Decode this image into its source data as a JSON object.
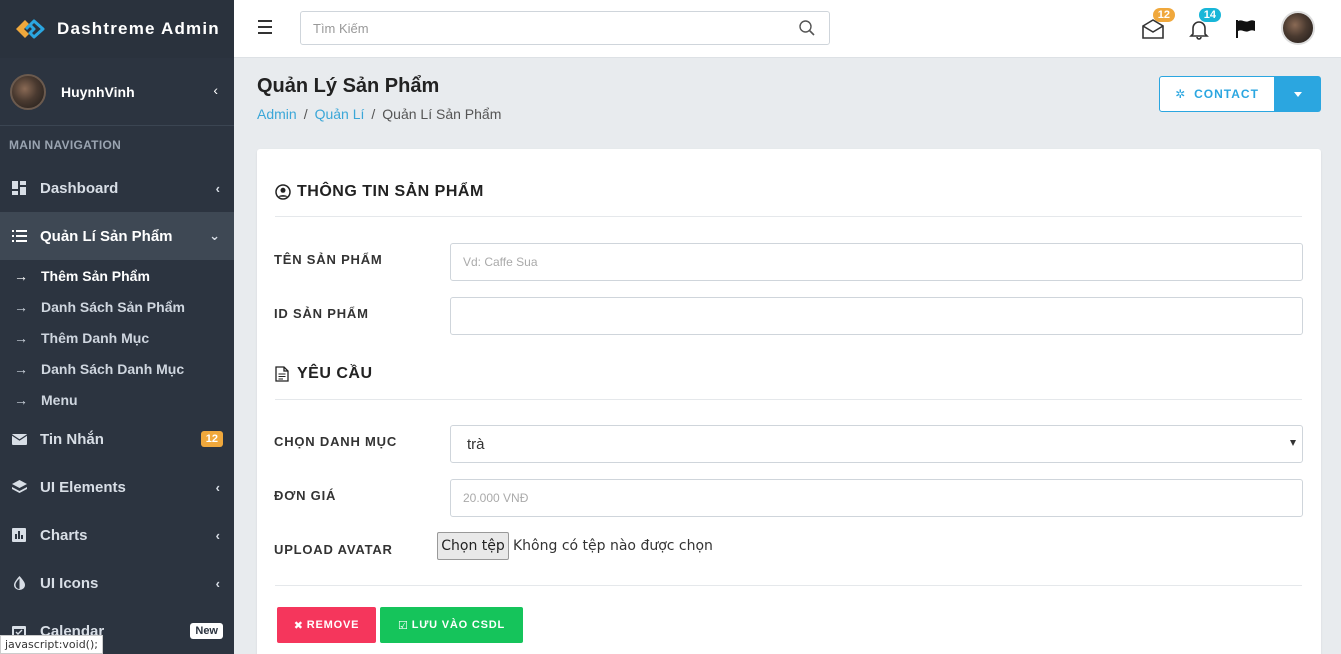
{
  "brand": {
    "name": "Dashtreme Admin"
  },
  "user": {
    "name": "HuynhVinh"
  },
  "sidebar": {
    "header": "MAIN NAVIGATION",
    "items": [
      {
        "label": "Dashboard",
        "icon": "dashboard-icon"
      },
      {
        "label": "Quản Lí Sản Phẩm",
        "icon": "list-icon"
      },
      {
        "label": "Tin Nhắn",
        "icon": "envelope-icon",
        "badge": "12"
      },
      {
        "label": "UI Elements",
        "icon": "layers-icon"
      },
      {
        "label": "Charts",
        "icon": "chart-icon"
      },
      {
        "label": "UI Icons",
        "icon": "contrast-icon"
      },
      {
        "label": "Calendar",
        "icon": "calendar-icon",
        "badge": "New"
      }
    ],
    "subitems": [
      {
        "label": "Thêm Sản Phẩm"
      },
      {
        "label": "Danh Sách Sản Phẩm"
      },
      {
        "label": "Thêm Danh Mục"
      },
      {
        "label": "Danh Sách Danh Mục"
      },
      {
        "label": "Menu"
      }
    ]
  },
  "status_tip": "javascript:void();",
  "topbar": {
    "search_placeholder": "Tìm Kiếm",
    "mail_badge": "12",
    "bell_badge": "14",
    "badge_colors": {
      "mail": "#f0a83c",
      "bell": "#18b6d8"
    }
  },
  "page": {
    "title": "Quản Lý Sản Phẩm",
    "breadcrumb": [
      "Admin",
      "Quản Lí",
      "Quản Lí Sản Phẩm"
    ],
    "contact_label": "CONTACT"
  },
  "form": {
    "section1_title": "THÔNG TIN SẢN PHẨM",
    "name_label": "TÊN SẢN PHẨM",
    "name_placeholder": "Vd: Caffe Sua",
    "id_label": "ID SẢN PHẨM",
    "id_value": "",
    "section2_title": "YÊU CẦU",
    "category_label": "CHỌN DANH MỤC",
    "category_value": "trà",
    "price_label": "ĐƠN GIÁ",
    "price_placeholder": "20.000 VNĐ",
    "avatar_label": "UPLOAD AVATAR",
    "file_button": "Chọn tệp",
    "file_status": "Không có tệp nào được chọn",
    "remove_label": "REMOVE",
    "save_label": "LƯU VÀO CSDL"
  },
  "colors": {
    "sidebar_bg": "#2c3440",
    "accent": "#2ba6e0",
    "remove": "#f5365c",
    "save": "#15c45b"
  }
}
